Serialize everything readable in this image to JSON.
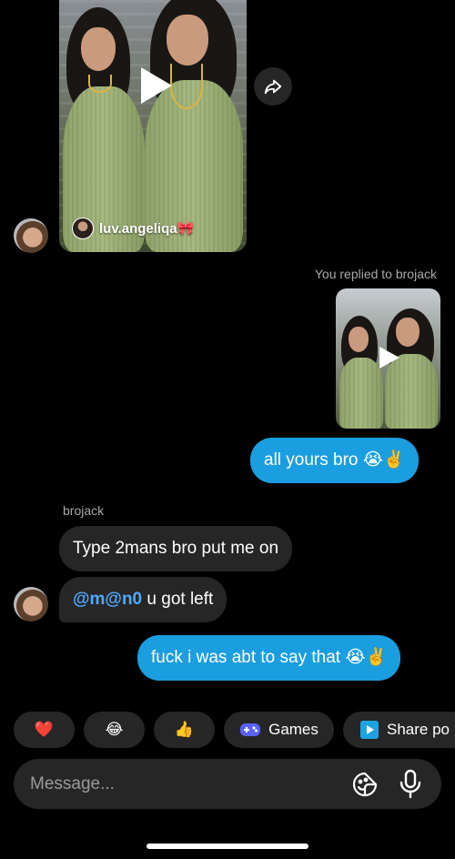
{
  "shared_reel": {
    "username": "luv.angeliqa🎀",
    "play_icon": "play-icon",
    "share_icon": "share-arrow-icon"
  },
  "reply_caption": "You replied to brojack",
  "messages": {
    "me_1": "all yours bro 😭✌️",
    "sender_name": "brojack",
    "them_1": "Type 2mans bro put me on",
    "them_2_mention": "@m@n0",
    "them_2_rest": " u got left",
    "me_2": "fuck i was abt to say that 😭✌️"
  },
  "quick_replies": [
    {
      "label": "❤️",
      "icon": "heart"
    },
    {
      "label": "😂",
      "icon": "laughing-emoji"
    },
    {
      "label": "👍",
      "icon": "thumbs-up"
    },
    {
      "label": "Games",
      "icon": "gamepad"
    },
    {
      "label": "Share po",
      "icon": "play-square"
    }
  ],
  "composer": {
    "placeholder": "Message...",
    "sticker_icon": "sticker-icon",
    "mic_icon": "microphone-icon"
  },
  "colors": {
    "background": "#000000",
    "my_bubble": "#1a9ee0",
    "their_bubble": "#262626",
    "mention": "#4fa8ff",
    "games_icon": "#5a63ff",
    "share_icon": "#1fa3e0"
  }
}
